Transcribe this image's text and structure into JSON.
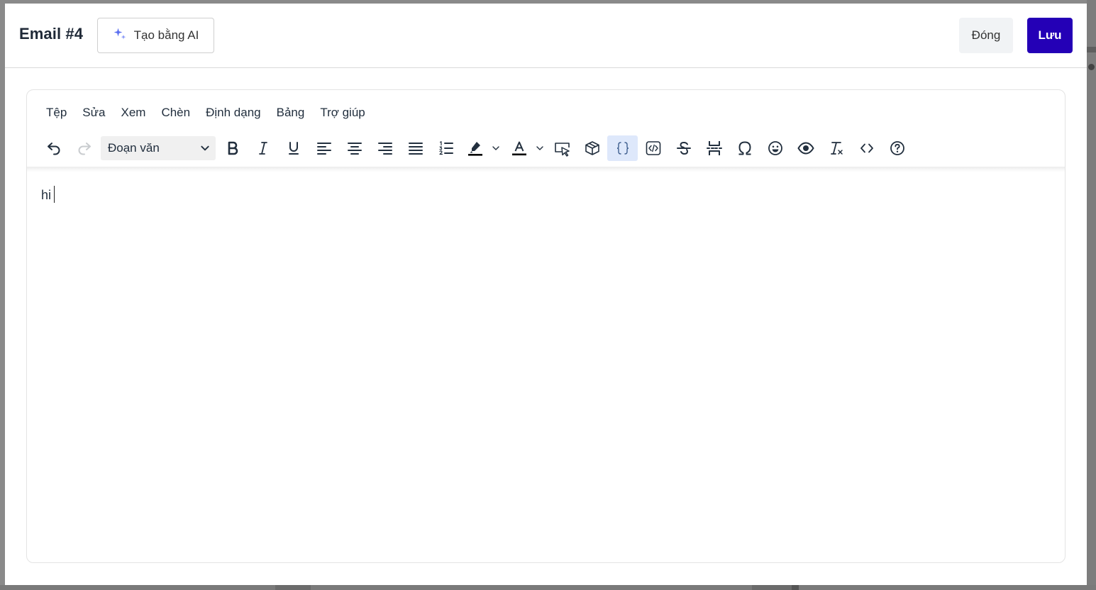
{
  "header": {
    "title": "Email #4",
    "ai_button_label": "Tạo bằng AI",
    "close_label": "Đóng",
    "save_label": "Lưu"
  },
  "editor": {
    "menu": [
      "Tệp",
      "Sửa",
      "Xem",
      "Chèn",
      "Định dạng",
      "Bảng",
      "Trợ giúp"
    ],
    "block_format": "Đoạn văn",
    "content": "hi"
  },
  "colors": {
    "primary": "#2400b6",
    "active_tool_bg": "#dee8fb",
    "ai_sparkle": "#5a6ff0"
  },
  "icons": {
    "toolbar": [
      "undo-icon",
      "redo-icon",
      "bold-icon",
      "italic-icon",
      "underline-icon",
      "align-left-icon",
      "align-center-icon",
      "align-right-icon",
      "align-justify-icon",
      "numbered-list-icon",
      "highlight-color-icon",
      "text-color-icon",
      "cursor-select-icon",
      "box-icon",
      "curly-braces-icon",
      "code-tag-icon",
      "strikethrough-icon",
      "page-break-icon",
      "omega-icon",
      "emoji-icon",
      "preview-eye-icon",
      "clear-format-icon",
      "source-code-icon",
      "help-icon"
    ]
  }
}
